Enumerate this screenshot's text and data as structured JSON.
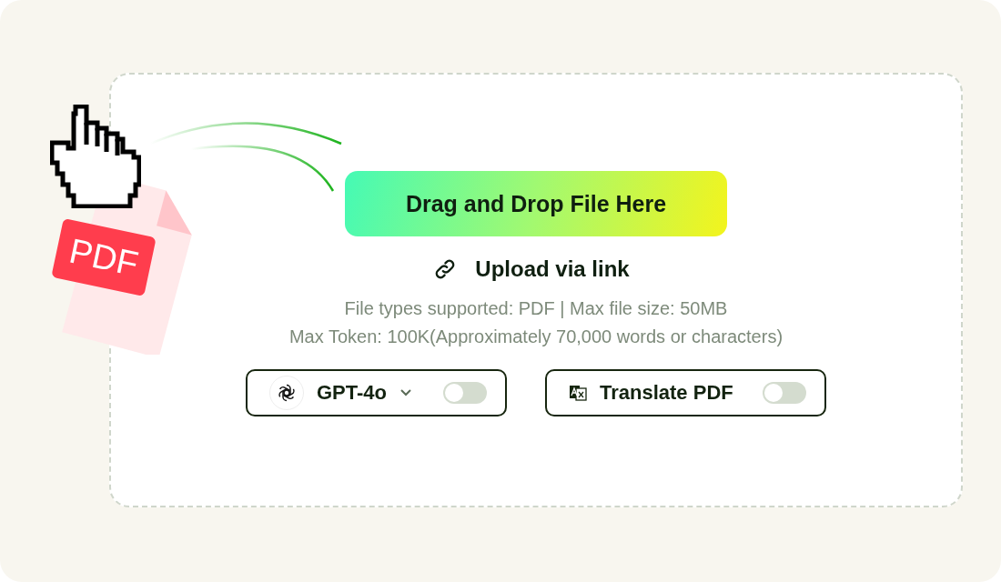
{
  "illustration": {
    "badge": "PDF"
  },
  "upload_button": {
    "label": "Drag and Drop File Here"
  },
  "link": {
    "label": "Upload via link"
  },
  "info": [
    "File types supported: PDF | Max file size: 50MB",
    "Max Token: 100K(Approximately 70,000 words or characters)"
  ],
  "options": [
    {
      "kind": "model",
      "label": "GPT-4o",
      "on": false
    },
    {
      "kind": "translate",
      "label": "Translate PDF",
      "on": false
    }
  ]
}
